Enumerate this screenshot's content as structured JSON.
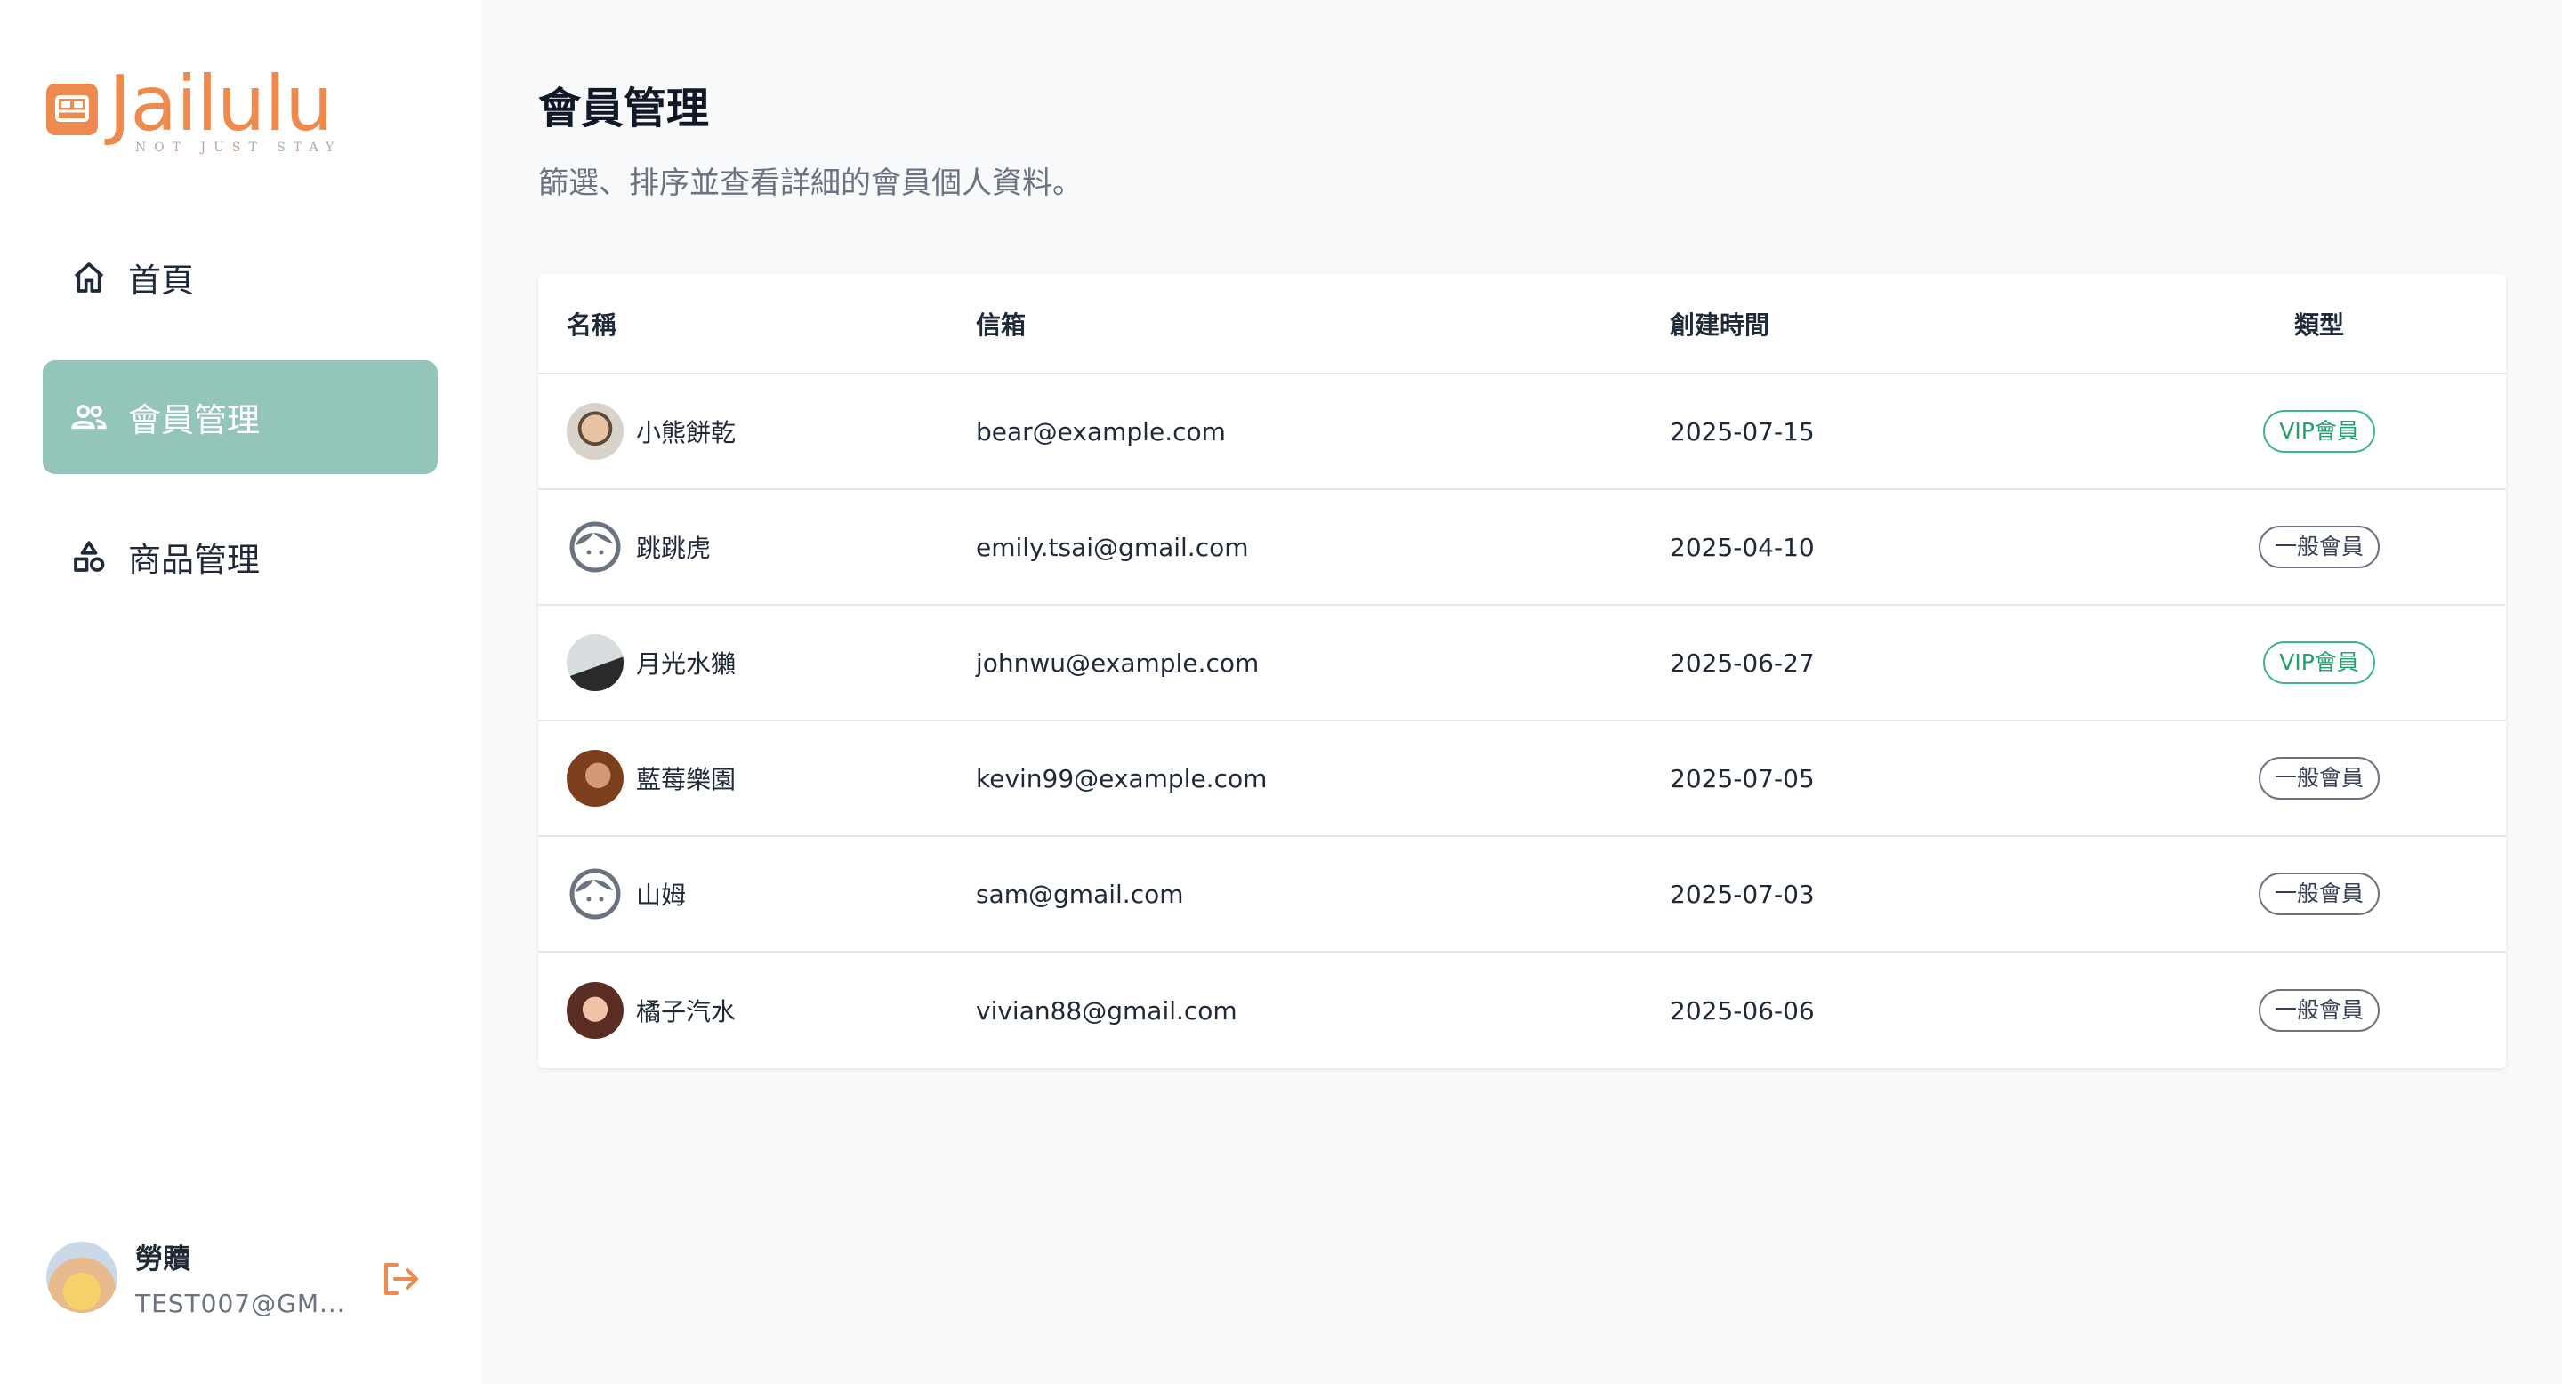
{
  "brand": {
    "name": "Jailulu",
    "tagline": "NOT JUST STAY",
    "color": "#ee8a4e"
  },
  "nav": [
    {
      "label": "首頁",
      "icon": "home-icon",
      "active": false
    },
    {
      "label": "會員管理",
      "icon": "users-icon",
      "active": true
    },
    {
      "label": "商品管理",
      "icon": "shapes-icon",
      "active": false
    }
  ],
  "user": {
    "name": "勞贖",
    "email": "TEST007@GM..."
  },
  "page": {
    "title": "會員管理",
    "subtitle": "篩選、排序並查看詳細的會員個人資料。"
  },
  "table": {
    "headers": {
      "name": "名稱",
      "email": "信箱",
      "created": "創建時間",
      "type": "類型"
    },
    "rows": [
      {
        "name": "小熊餅乾",
        "email": "bear@example.com",
        "created": "2025-07-15",
        "type": "VIP會員",
        "vip": true,
        "avatar": "photo"
      },
      {
        "name": "跳跳虎",
        "email": "emily.tsai@gmail.com",
        "created": "2025-04-10",
        "type": "一般會員",
        "vip": false,
        "avatar": "default"
      },
      {
        "name": "月光水獺",
        "email": "johnwu@example.com",
        "created": "2025-06-27",
        "type": "VIP會員",
        "vip": true,
        "avatar": "photo"
      },
      {
        "name": "藍莓樂園",
        "email": "kevin99@example.com",
        "created": "2025-07-05",
        "type": "一般會員",
        "vip": false,
        "avatar": "photo"
      },
      {
        "name": "山姆",
        "email": "sam@gmail.com",
        "created": "2025-07-03",
        "type": "一般會員",
        "vip": false,
        "avatar": "default"
      },
      {
        "name": "橘子汽水",
        "email": "vivian88@gmail.com",
        "created": "2025-06-06",
        "type": "一般會員",
        "vip": false,
        "avatar": "photo"
      }
    ]
  },
  "colors": {
    "accent": "#93c5bb",
    "vip": "#22a06b",
    "logout": "#ee8a4e"
  }
}
